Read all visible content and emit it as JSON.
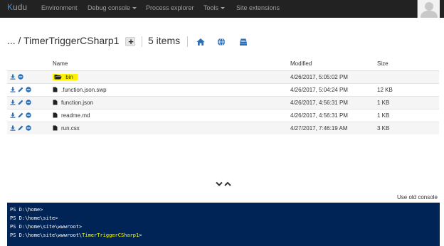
{
  "navbar": {
    "brand_k": "K",
    "brand_rest": "udu",
    "items": [
      {
        "label": "Environment"
      },
      {
        "label": "Debug console",
        "dropdown": true
      },
      {
        "label": "Process explorer"
      },
      {
        "label": "Tools",
        "dropdown": true
      },
      {
        "label": "Site extensions"
      }
    ]
  },
  "breadcrumb": {
    "path": "... / TimerTriggerCSharp1",
    "add_label": "+",
    "item_count": "5 items"
  },
  "toolbar_icons": [
    "home-icon",
    "globe-icon",
    "drive-icon"
  ],
  "table": {
    "headers": {
      "name": "Name",
      "modified": "Modified",
      "size": "Size"
    },
    "rows": [
      {
        "name": "bin",
        "modified": "4/26/2017, 5:05:02 PM",
        "size": "",
        "type": "folder",
        "highlighted": true
      },
      {
        "name": ".function.json.swp",
        "modified": "4/26/2017, 5:04:24 PM",
        "size": "12 KB",
        "type": "file"
      },
      {
        "name": "function.json",
        "modified": "4/26/2017, 4:56:31 PM",
        "size": "1 KB",
        "type": "file"
      },
      {
        "name": "readme.md",
        "modified": "4/26/2017, 4:56:31 PM",
        "size": "1 KB",
        "type": "file"
      },
      {
        "name": "run.csx",
        "modified": "4/27/2017, 7:46:19 AM",
        "size": "3 KB",
        "type": "file"
      }
    ]
  },
  "old_console_label": "Use old console",
  "console": {
    "lines": [
      {
        "text": "PS D:\\home>"
      },
      {
        "text": "PS D:\\home\\site>"
      },
      {
        "text": "PS D:\\home\\site\\wwwroot>"
      },
      {
        "prefix": "PS D:\\home\\site\\wwwroot\\",
        "highlight": "TimerTriggerCSharp1",
        "suffix": ">"
      }
    ]
  },
  "colors": {
    "navbar_bg": "#222222",
    "accent_blue": "#2a6fb7",
    "console_bg": "#012456",
    "highlight": "#fff200"
  }
}
